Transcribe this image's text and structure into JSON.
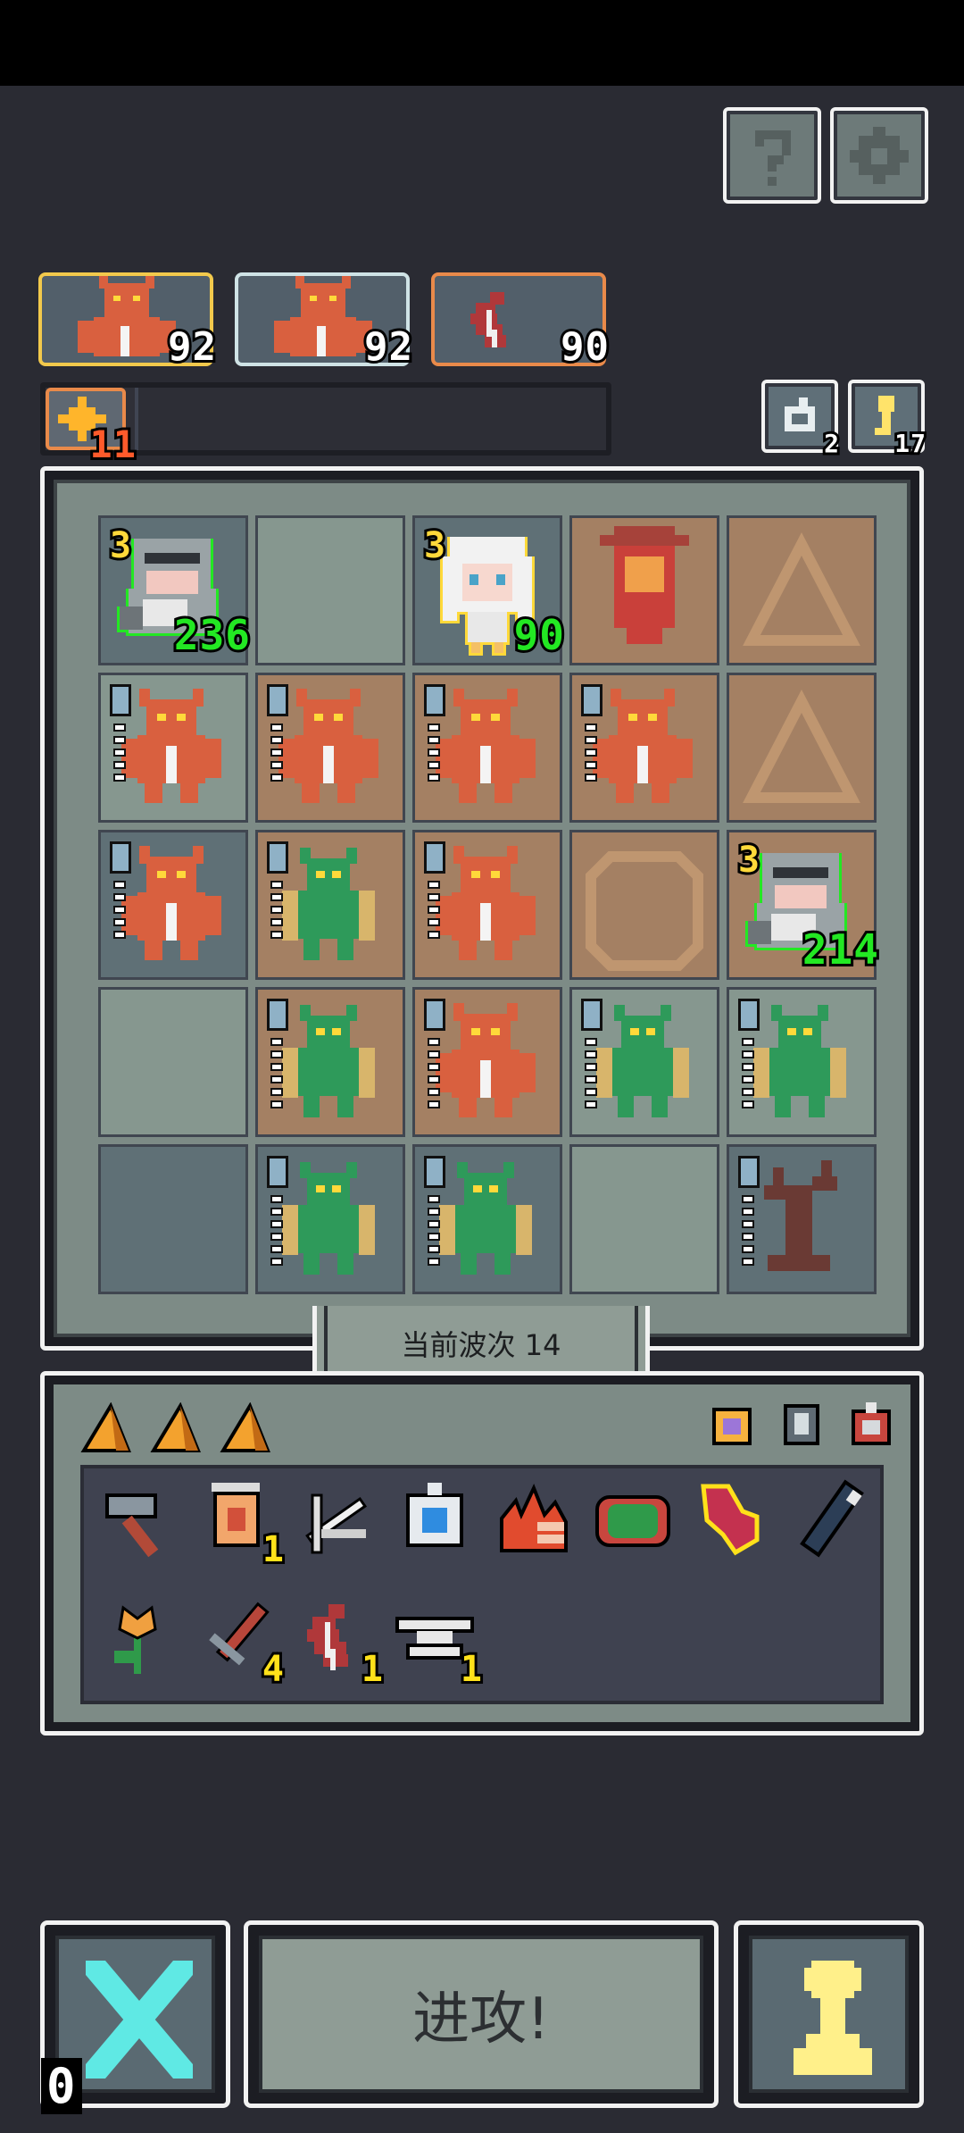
{
  "header": {
    "help_icon": "question-mark-icon",
    "settings_icon": "gear-icon"
  },
  "enemies": [
    {
      "icon": "red-demon-icon",
      "value": "92",
      "border": "#f2c94c"
    },
    {
      "icon": "red-demon-icon",
      "value": "92",
      "border": "#cfe3e6"
    },
    {
      "icon": "red-leaf-icon",
      "value": "90",
      "border": "#e98a4a"
    }
  ],
  "buff": {
    "icon": "star-burst-icon",
    "value": "11"
  },
  "counters": {
    "reroll": {
      "icon": "cycle-arrow-icon",
      "value": "2"
    },
    "key": {
      "icon": "key-icon",
      "value": "17"
    }
  },
  "board": {
    "cells": [
      {
        "row": 0,
        "col": 0,
        "bg": "dark",
        "unit": "armored-knight-icon",
        "level": "3",
        "hp": "236",
        "highlight": "#23e823"
      },
      {
        "row": 0,
        "col": 1,
        "bg": "light"
      },
      {
        "row": 0,
        "col": 2,
        "bg": "dark",
        "unit": "white-haired-girl-icon",
        "level": "3",
        "hp": "90",
        "highlight": "#ffd93a"
      },
      {
        "row": 0,
        "col": 3,
        "bg": "tan",
        "unit": "red-banner-icon"
      },
      {
        "row": 0,
        "col": 4,
        "bg": "tan",
        "tile": "triangle-rune-icon"
      },
      {
        "row": 1,
        "col": 0,
        "bg": "light",
        "unit": "red-demon-icon",
        "level": "0",
        "ticks": 5
      },
      {
        "row": 1,
        "col": 1,
        "bg": "tan",
        "unit": "red-demon-icon",
        "level": "0",
        "ticks": 5
      },
      {
        "row": 1,
        "col": 2,
        "bg": "tan",
        "unit": "red-demon-icon",
        "level": "0",
        "ticks": 5
      },
      {
        "row": 1,
        "col": 3,
        "bg": "tan",
        "unit": "red-demon-icon",
        "level": "0",
        "ticks": 5
      },
      {
        "row": 1,
        "col": 4,
        "bg": "tan",
        "tile": "triangle-rune-icon"
      },
      {
        "row": 2,
        "col": 0,
        "bg": "dark",
        "unit": "red-demon-icon",
        "level": "0",
        "ticks": 5
      },
      {
        "row": 2,
        "col": 1,
        "bg": "tan",
        "unit": "green-mantis-icon",
        "level": "0",
        "ticks": 5
      },
      {
        "row": 2,
        "col": 2,
        "bg": "tan",
        "unit": "red-demon-icon",
        "level": "0",
        "ticks": 5
      },
      {
        "row": 2,
        "col": 3,
        "bg": "tan",
        "tile": "octagon-rune-icon"
      },
      {
        "row": 2,
        "col": 4,
        "bg": "tan",
        "unit": "armored-knight-icon",
        "level": "3",
        "hp": "214",
        "highlight": "#23e823"
      },
      {
        "row": 3,
        "col": 0,
        "bg": "light"
      },
      {
        "row": 3,
        "col": 1,
        "bg": "tan",
        "unit": "green-mantis-icon",
        "level": "0",
        "ticks": 6
      },
      {
        "row": 3,
        "col": 2,
        "bg": "tan",
        "unit": "red-demon-icon",
        "level": "0",
        "ticks": 6
      },
      {
        "row": 3,
        "col": 3,
        "bg": "light",
        "unit": "green-mantis-icon",
        "level": "0",
        "ticks": 6
      },
      {
        "row": 3,
        "col": 4,
        "bg": "light",
        "unit": "green-mantis-icon",
        "level": "0",
        "ticks": 6
      },
      {
        "row": 4,
        "col": 0,
        "bg": "dark"
      },
      {
        "row": 4,
        "col": 1,
        "bg": "dark",
        "unit": "green-mantis-icon",
        "level": "0",
        "ticks": 6
      },
      {
        "row": 4,
        "col": 2,
        "bg": "dark",
        "unit": "green-mantis-icon",
        "level": "0",
        "ticks": 6
      },
      {
        "row": 4,
        "col": 3,
        "bg": "light"
      },
      {
        "row": 4,
        "col": 4,
        "bg": "dark",
        "unit": "dead-tree-icon",
        "level": "0",
        "ticks": 6
      }
    ]
  },
  "wave": {
    "label": "当前波次 14"
  },
  "inventory": {
    "tabs": [
      "orange-wedge-icon",
      "orange-wedge-icon",
      "orange-wedge-icon"
    ],
    "right_icons": [
      "purple-gem-ring-icon",
      "spiked-armor-icon",
      "red-ring-icon"
    ],
    "items": [
      {
        "icon": "hammer-icon",
        "count": ""
      },
      {
        "icon": "lantern-icon",
        "count": "1"
      },
      {
        "icon": "crossbow-icon",
        "count": ""
      },
      {
        "icon": "blue-gem-amulet-icon",
        "count": ""
      },
      {
        "icon": "flame-icon",
        "count": ""
      },
      {
        "icon": "green-scarab-icon",
        "count": ""
      },
      {
        "icon": "red-fish-icon",
        "count": ""
      },
      {
        "icon": "dark-spear-icon",
        "count": ""
      },
      {
        "icon": "flower-icon",
        "count": ""
      },
      {
        "icon": "sword-icon",
        "count": "4"
      },
      {
        "icon": "red-leaf-icon",
        "count": "1"
      },
      {
        "icon": "anvil-icon",
        "count": "1"
      }
    ]
  },
  "actions": {
    "cancel_icon": "cross-icon",
    "cancel_count": "0",
    "attack_label": "进攻!",
    "pawn_icon": "pawn-icon"
  },
  "colors": {
    "background": "#2a2b33",
    "panel": "#7d8b86",
    "hp_green": "#23e823",
    "level_yellow": "#ffd93a",
    "count_yellow": "#ffe11a",
    "cross_cyan": "#5fe9e4",
    "pawn_yellow": "#fff08a"
  }
}
